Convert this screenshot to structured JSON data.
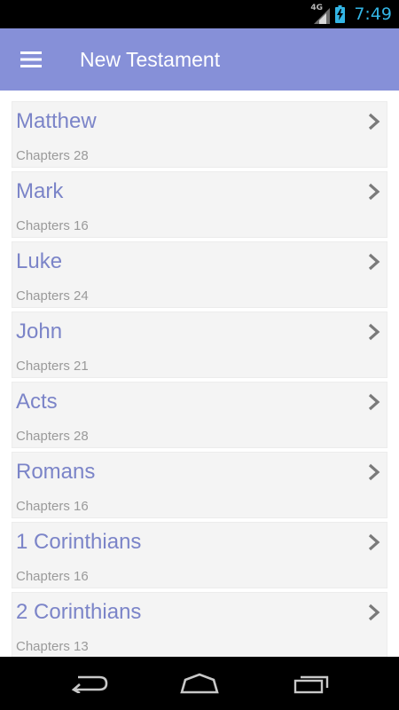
{
  "status_bar": {
    "network": "4G",
    "time": "7:49",
    "colors": {
      "clock": "#33b5e5",
      "battery": "#33b5e5"
    },
    "icons": [
      "signal-icon",
      "battery-charging-icon"
    ]
  },
  "app_bar": {
    "title": "New Testament",
    "menu_icon": "hamburger-menu-icon",
    "color": "#8690d8"
  },
  "books": [
    {
      "name": "Matthew",
      "chapters": "Chapters 28"
    },
    {
      "name": "Mark",
      "chapters": "Chapters 16"
    },
    {
      "name": "Luke",
      "chapters": "Chapters 24"
    },
    {
      "name": "John",
      "chapters": "Chapters 21"
    },
    {
      "name": "Acts",
      "chapters": "Chapters 28"
    },
    {
      "name": "Romans",
      "chapters": "Chapters 16"
    },
    {
      "name": "1 Corinthians",
      "chapters": "Chapters 16"
    },
    {
      "name": "2 Corinthians",
      "chapters": "Chapters 13"
    }
  ],
  "item_icon": "chevron-right-icon",
  "nav_bar": {
    "icons": [
      "back-icon",
      "home-icon",
      "recent-apps-icon"
    ]
  }
}
